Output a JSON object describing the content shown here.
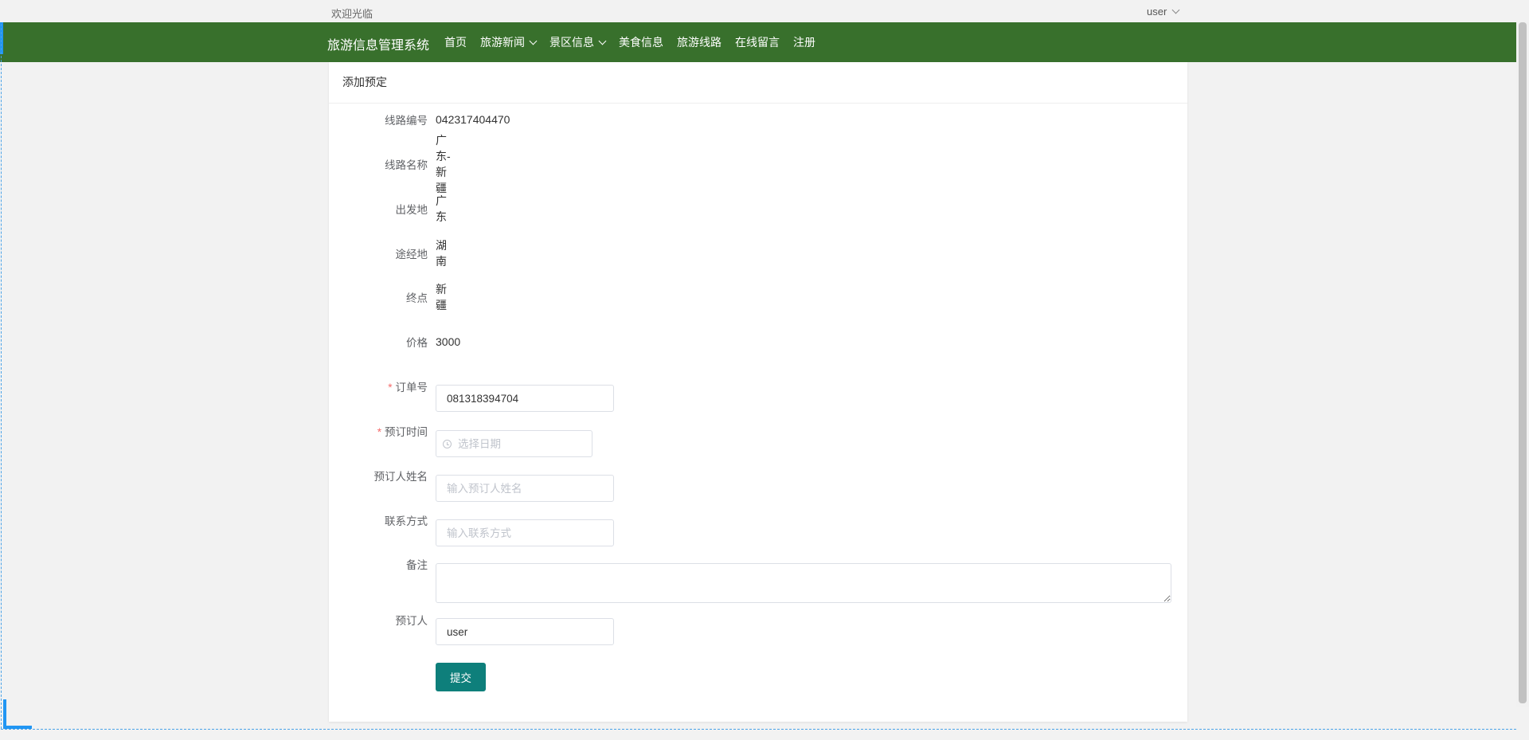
{
  "topbar": {
    "welcome": "欢迎光临",
    "user": "user"
  },
  "navbar": {
    "brand": "旅游信息管理系统",
    "items": [
      {
        "label": "首页",
        "dropdown": false
      },
      {
        "label": "旅游新闻",
        "dropdown": true
      },
      {
        "label": "景区信息",
        "dropdown": true
      },
      {
        "label": "美食信息",
        "dropdown": false
      },
      {
        "label": "旅游线路",
        "dropdown": false
      },
      {
        "label": "在线留言",
        "dropdown": false
      },
      {
        "label": "注册",
        "dropdown": false
      }
    ]
  },
  "card": {
    "title": "添加预定"
  },
  "form": {
    "route_no": {
      "label": "线路编号",
      "value": "042317404470"
    },
    "route_name": {
      "label": "线路名称",
      "value": "广东-新疆"
    },
    "departure": {
      "label": "出发地",
      "value": "广东"
    },
    "via": {
      "label": "途经地",
      "value": "湖南"
    },
    "destination": {
      "label": "终点",
      "value": "新疆"
    },
    "price": {
      "label": "价格",
      "value": "3000"
    },
    "order_no": {
      "label": "订单号",
      "required": true,
      "value": "081318394704"
    },
    "booking_time": {
      "label": "预订时间",
      "required": true,
      "placeholder": "选择日期"
    },
    "booker_name": {
      "label": "预订人姓名",
      "placeholder": "输入预订人姓名"
    },
    "contact": {
      "label": "联系方式",
      "placeholder": "输入联系方式"
    },
    "remark": {
      "label": "备注",
      "value": ""
    },
    "booker": {
      "label": "预订人",
      "value": "user"
    },
    "submit_label": "提交"
  },
  "colors": {
    "nav_bg": "#38702c",
    "button": "#0e7f7b",
    "required": "#f56c6c"
  }
}
